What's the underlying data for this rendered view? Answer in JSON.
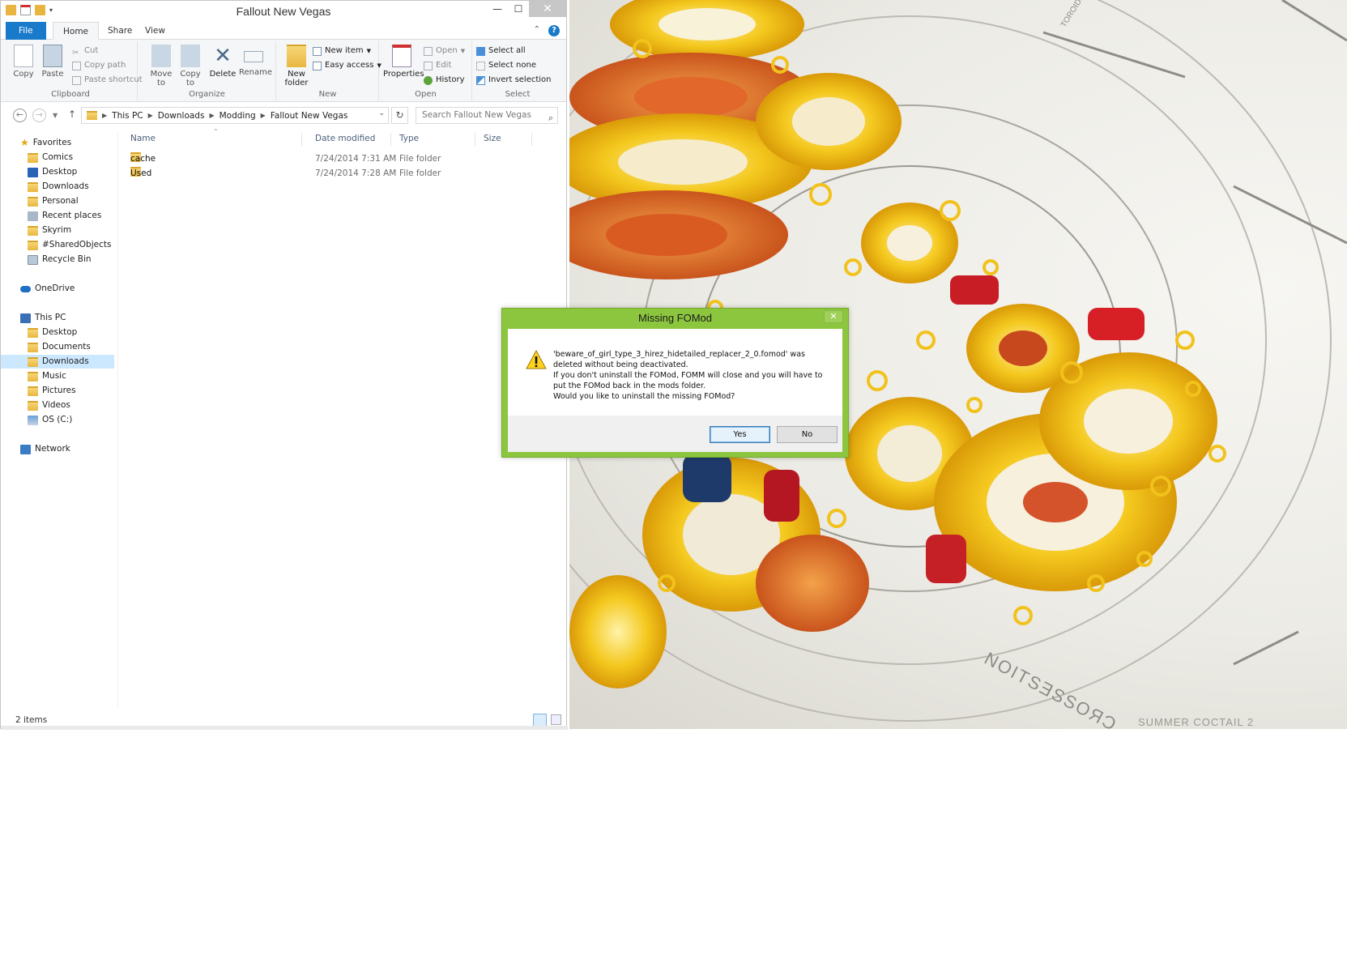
{
  "window": {
    "title": "Fallout New Vegas",
    "minimize": "—",
    "maximize": "☐",
    "close": "✕"
  },
  "ribbon": {
    "tabs": {
      "file": "File",
      "home": "Home",
      "share": "Share",
      "view": "View"
    },
    "clipboard": {
      "label": "Clipboard",
      "copy": "Copy",
      "paste": "Paste",
      "cut": "Cut",
      "copy_path": "Copy path",
      "paste_shortcut": "Paste shortcut"
    },
    "organize": {
      "label": "Organize",
      "move_to": "Move to",
      "copy_to": "Copy to",
      "delete": "Delete",
      "rename": "Rename"
    },
    "new": {
      "label": "New",
      "new_folder": "New folder",
      "new_item": "New item",
      "easy_access": "Easy access"
    },
    "open": {
      "label": "Open",
      "properties": "Properties",
      "open": "Open",
      "edit": "Edit",
      "history": "History"
    },
    "select": {
      "label": "Select",
      "select_all": "Select all",
      "select_none": "Select none",
      "invert_selection": "Invert selection"
    }
  },
  "address": {
    "crumbs": [
      "This PC",
      "Downloads",
      "Modding",
      "Fallout New Vegas"
    ],
    "search_placeholder": "Search Fallout New Vegas"
  },
  "nav": {
    "favorites": {
      "label": "Favorites",
      "items": [
        "Comics",
        "Desktop",
        "Downloads",
        "Personal",
        "Recent places",
        "Skyrim",
        "#SharedObjects",
        "Recycle Bin"
      ]
    },
    "onedrive": "OneDrive",
    "this_pc": {
      "label": "This PC",
      "items": [
        "Desktop",
        "Documents",
        "Downloads",
        "Music",
        "Pictures",
        "Videos",
        "OS (C:)"
      ]
    },
    "network": "Network"
  },
  "file_list": {
    "columns": {
      "name": "Name",
      "date": "Date modified",
      "type": "Type",
      "size": "Size"
    },
    "rows": [
      {
        "name": "cache",
        "date": "7/24/2014 7:31 AM",
        "type": "File folder"
      },
      {
        "name": "Used",
        "date": "7/24/2014 7:28 AM",
        "type": "File folder"
      }
    ]
  },
  "status": {
    "count": "2 items"
  },
  "dialog": {
    "title": "Missing FOMod",
    "close": "✕",
    "lines": [
      "'beware_of_girl_type_3_hirez_hidetailed_replacer_2_0.fomod' was",
      "deleted without being deactivated.",
      "If you don't uninstall the FOMod, FOMM will close and you will have to",
      "put the FOMod back in the mods folder.",
      "Would you like to uninstall the missing FOMod?"
    ],
    "yes": "Yes",
    "no": "No"
  },
  "wallpaper": {
    "label_cross": "NOITSƎSSOЯƆ",
    "label_summer": "SUMMER COCTAIL 2",
    "label_torus": "TOROIDED BEAD"
  },
  "colors": {
    "accent": "#1979ca",
    "dialog_frame": "#8cc63f",
    "selection": "#cce8ff"
  }
}
